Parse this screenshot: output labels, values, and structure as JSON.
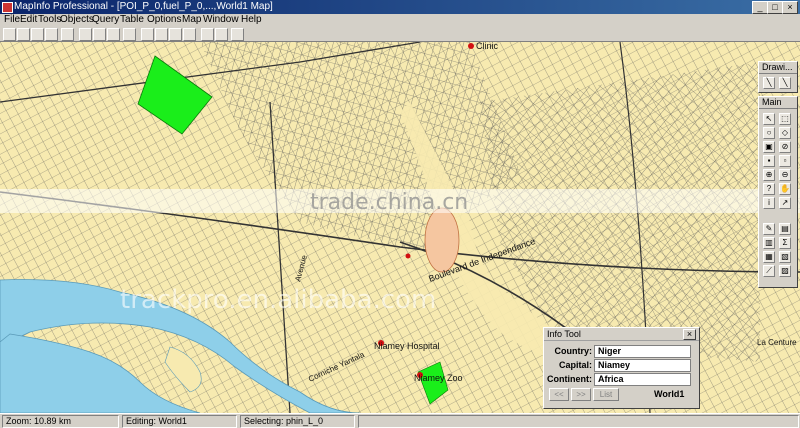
{
  "window": {
    "title": "MapInfo Professional - [POI_P_0,fuel_P_0,...,World1 Map]"
  },
  "menu": [
    "File",
    "Edit",
    "Tools",
    "Objects",
    "Query",
    "Table",
    "Options",
    "Map",
    "Window",
    "Help"
  ],
  "map": {
    "labels": {
      "clinic": "Clinic",
      "boulevard": "Boulevard de Independance",
      "niamey_hospital": "Niamey Hospital",
      "niamey_zoo": "Niamey Zoo",
      "la_centure": "La Centure",
      "corniche": "Corniche Yantala",
      "road_ave": "Avenue"
    }
  },
  "watermarks": {
    "primary": "trade.china.cn",
    "secondary": "trackpro.en.alibaba.com"
  },
  "palettes": {
    "drawing_title": "Drawi...",
    "main_title": "Main"
  },
  "info_tool": {
    "title": "Info Tool",
    "rows": [
      {
        "label": "Country:",
        "value": "Niger"
      },
      {
        "label": "Capital:",
        "value": "Niamey"
      },
      {
        "label": "Continent:",
        "value": "Africa"
      }
    ],
    "buttons": {
      "prev": "<<",
      "next": ">>",
      "list": "List"
    },
    "layer": "World1"
  },
  "status": {
    "zoom": "Zoom: 10.89 km",
    "editing": "Editing: World1",
    "selecting": "Selecting: phin_L_0"
  },
  "colors": {
    "map_bg": "#f7eab0",
    "river": "#8ecfe9",
    "park_green": "#1aee1a",
    "stadium": "#f5c6a0",
    "roads": "#555555"
  }
}
